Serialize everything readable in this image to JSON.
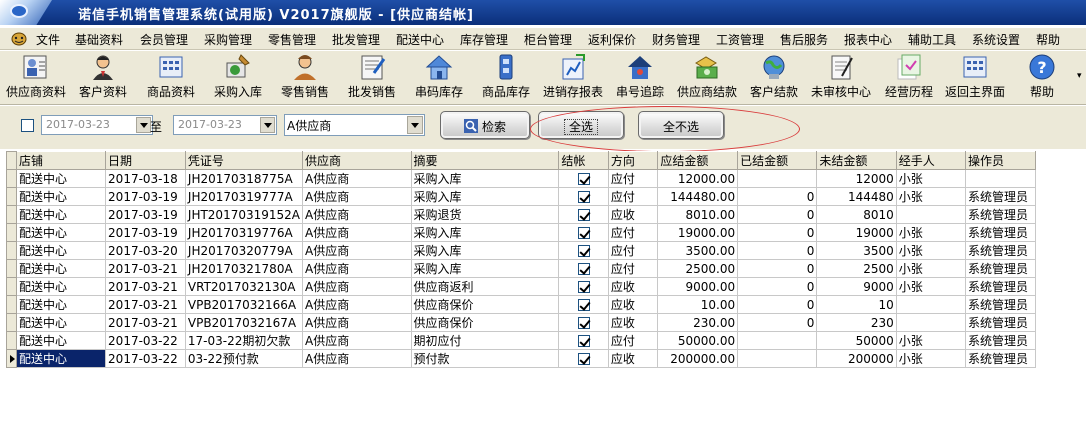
{
  "window": {
    "title": "诺信手机销售管理系统(试用版)  V2017旗舰版 - [供应商结帐]"
  },
  "menu": [
    "文件",
    "基础资料",
    "会员管理",
    "采购管理",
    "零售管理",
    "批发管理",
    "配送中心",
    "库存管理",
    "柜台管理",
    "返利保价",
    "财务管理",
    "工资管理",
    "售后服务",
    "报表中心",
    "辅助工具",
    "系统设置",
    "帮助"
  ],
  "toolbar": [
    "供应商资料",
    "客户资料",
    "商品资料",
    "采购入库",
    "零售销售",
    "批发销售",
    "串码库存",
    "商品库存",
    "进销存报表",
    "串号追踪",
    "供应商结款",
    "客户结款",
    "未审核中心",
    "经营历程",
    "返回主界面",
    "帮助"
  ],
  "filter": {
    "date_from": "2017-03-23",
    "to_label": "至",
    "date_to": "2017-03-23",
    "supplier": "A供应商",
    "search_label": "检索",
    "select_all_label": "全选",
    "deselect_all_label": "全不选"
  },
  "table": {
    "columns": [
      "店铺",
      "日期",
      "凭证号",
      "供应商",
      "摘要",
      "结帐",
      "方向",
      "应结金额",
      "已结金额",
      "未结金额",
      "经手人",
      "操作员"
    ],
    "rows": [
      [
        "配送中心",
        "2017-03-18",
        "JH20170318775A",
        "A供应商",
        "采购入库",
        "",
        "应付",
        "12000.00",
        "",
        "12000",
        "小张",
        ""
      ],
      [
        "配送中心",
        "2017-03-19",
        "JH20170319777A",
        "A供应商",
        "采购入库",
        "",
        "应付",
        "144480.00",
        "0",
        "144480",
        "小张",
        "系统管理员"
      ],
      [
        "配送中心",
        "2017-03-19",
        "JHT20170319152A",
        "A供应商",
        "采购退货",
        "",
        "应收",
        "8010.00",
        "0",
        "8010",
        "",
        "系统管理员"
      ],
      [
        "配送中心",
        "2017-03-19",
        "JH20170319776A",
        "A供应商",
        "采购入库",
        "",
        "应付",
        "19000.00",
        "0",
        "19000",
        "小张",
        "系统管理员"
      ],
      [
        "配送中心",
        "2017-03-20",
        "JH20170320779A",
        "A供应商",
        "采购入库",
        "",
        "应付",
        "3500.00",
        "0",
        "3500",
        "小张",
        "系统管理员"
      ],
      [
        "配送中心",
        "2017-03-21",
        "JH20170321780A",
        "A供应商",
        "采购入库",
        "",
        "应付",
        "2500.00",
        "0",
        "2500",
        "小张",
        "系统管理员"
      ],
      [
        "配送中心",
        "2017-03-21",
        "VRT2017032130A",
        "A供应商",
        "供应商返利",
        "",
        "应收",
        "9000.00",
        "0",
        "9000",
        "小张",
        "系统管理员"
      ],
      [
        "配送中心",
        "2017-03-21",
        "VPB2017032166A",
        "A供应商",
        "供应商保价",
        "",
        "应收",
        "10.00",
        "0",
        "10",
        "",
        "系统管理员"
      ],
      [
        "配送中心",
        "2017-03-21",
        "VPB2017032167A",
        "A供应商",
        "供应商保价",
        "",
        "应收",
        "230.00",
        "0",
        "230",
        "",
        "系统管理员"
      ],
      [
        "配送中心",
        "2017-03-22",
        "17-03-22期初欠款",
        "A供应商",
        "期初应付",
        "",
        "应付",
        "50000.00",
        "",
        "50000",
        "小张",
        "系统管理员"
      ],
      [
        "配送中心",
        "2017-03-22",
        "03-22预付款",
        "A供应商",
        "预付款",
        "",
        "应收",
        "200000.00",
        "",
        "200000",
        "小张",
        "系统管理员"
      ]
    ]
  }
}
